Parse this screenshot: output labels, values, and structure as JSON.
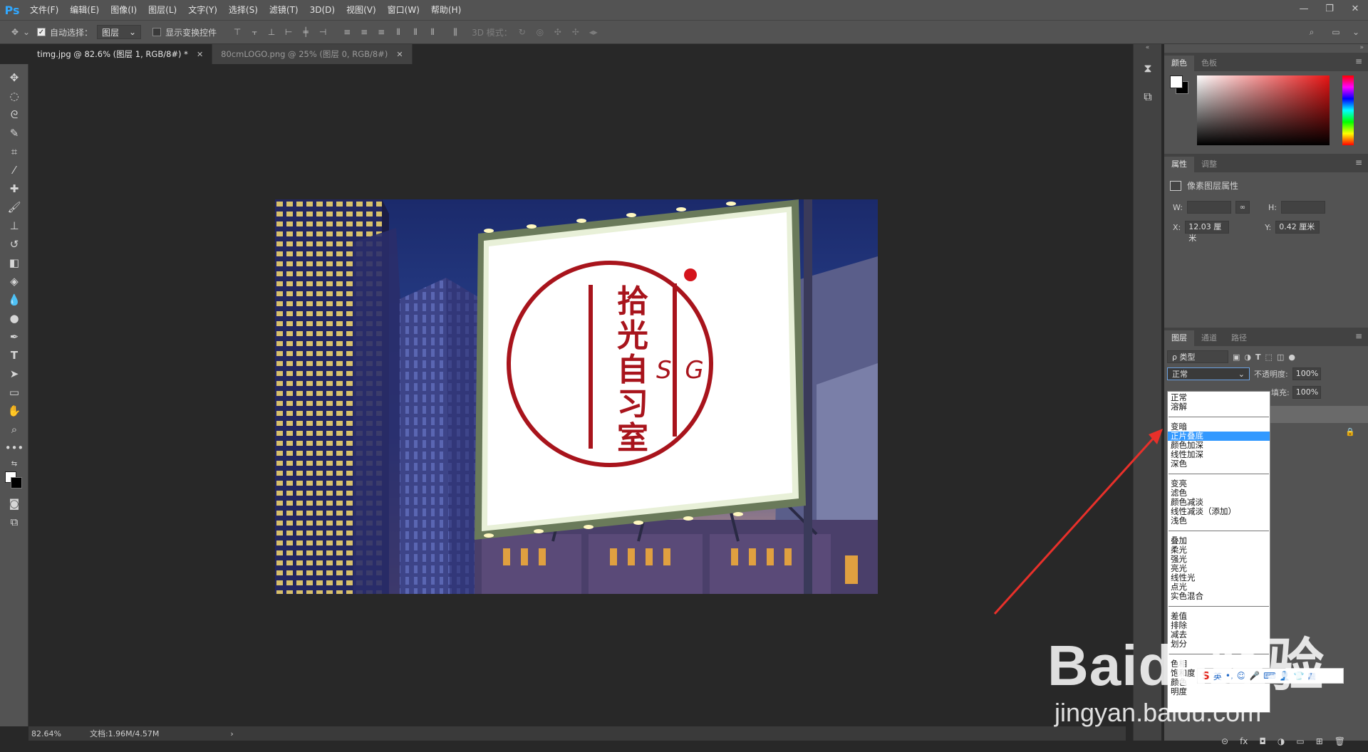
{
  "app": {
    "logo": "Ps"
  },
  "menu": [
    "文件(F)",
    "编辑(E)",
    "图像(I)",
    "图层(L)",
    "文字(Y)",
    "选择(S)",
    "滤镜(T)",
    "3D(D)",
    "视图(V)",
    "窗口(W)",
    "帮助(H)"
  ],
  "window_controls": {
    "minimize": "—",
    "restore": "❐",
    "close": "✕"
  },
  "options": {
    "auto_select_label": "自动选择：",
    "auto_select_value": "图层",
    "show_transform_label": "显示变换控件",
    "mode_3d_label": "3D 模式："
  },
  "tabs": [
    {
      "label": "timg.jpg @ 82.6% (图层 1, RGB/8#) *",
      "close": "✕"
    },
    {
      "label": "80cmLOGO.png @ 25% (图层 0, RGB/8#)",
      "close": "✕"
    }
  ],
  "status": {
    "zoom": "82.64%",
    "doc": "文档:1.96M/4.57M",
    "arrow": "›"
  },
  "artwork": {
    "title_chars": [
      "拾",
      "光",
      "自",
      "习",
      "室"
    ],
    "sg_letters": "S G"
  },
  "color_panel": {
    "tabs": [
      "颜色",
      "色板"
    ],
    "menu": "≡"
  },
  "properties_panel": {
    "tabs": [
      "属性",
      "调整"
    ],
    "title": "像素图层属性",
    "w_label": "W:",
    "h_label": "H:",
    "x_label": "X:",
    "x_value": "12.03 厘米",
    "y_label": "Y:",
    "y_value": "0.42 厘米"
  },
  "layers_panel": {
    "tabs": [
      "图层",
      "通道",
      "路径"
    ],
    "filter_value": "ρ 类型",
    "blend_value": "正常",
    "opacity_label": "不透明度:",
    "opacity_value": "100%",
    "fill_label": "填充:",
    "fill_value": "100%",
    "footer_icons": [
      "⊝",
      "fx",
      "◘",
      "◑",
      "▭",
      "⊞",
      "🗑"
    ]
  },
  "blend_groups": [
    [
      "正常",
      "溶解"
    ],
    [
      "变暗",
      "正片叠底",
      "颜色加深",
      "线性加深",
      "深色"
    ],
    [
      "变亮",
      "滤色",
      "颜色减淡",
      "线性减淡（添加）",
      "浅色"
    ],
    [
      "叠加",
      "柔光",
      "强光",
      "亮光",
      "线性光",
      "点光",
      "实色混合"
    ],
    [
      "差值",
      "排除",
      "减去",
      "划分"
    ],
    [
      "色相",
      "饱和度",
      "颜色",
      "明度"
    ]
  ],
  "blend_selected": "正片叠底",
  "ime": {
    "logo": "S",
    "lang": "英"
  },
  "watermark": {
    "main": "Baidu经验",
    "sub": "jingyan.baidu.com"
  },
  "colors": {
    "accent": "#31a8ff",
    "logo_red": "#a8141c",
    "selection": "#3399ff",
    "arrow": "#e8302a"
  }
}
